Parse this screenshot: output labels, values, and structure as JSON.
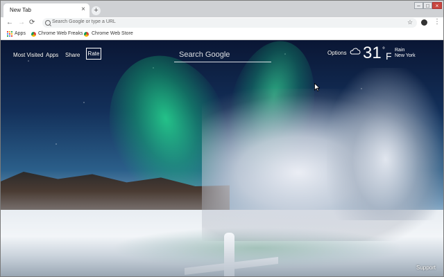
{
  "browser": {
    "tab_title": "New Tab",
    "tab_close": "×",
    "new_tab": "+",
    "window_controls": {
      "minimize": "–",
      "maximize": "□",
      "close": "×"
    },
    "toolbar": {
      "back": "←",
      "forward": "→",
      "reload": "⟳",
      "omnibox_placeholder": "Search Google or type a URL",
      "star": "☆",
      "menu": "⋮"
    },
    "bookmarks": [
      "Apps",
      "Chrome Web Freaks",
      "Chrome Web Store"
    ]
  },
  "page": {
    "links": [
      "Most Visited",
      "Apps",
      "Share"
    ],
    "rate_label": "Rate",
    "search_placeholder": "Search Google",
    "options_label": "Options",
    "weather": {
      "temperature": "31",
      "degree_symbol": "°",
      "unit": "F",
      "condition": "Rain",
      "city": "New York"
    },
    "support_label": "Support"
  },
  "colors": {
    "apps_grid": [
      "#ea4335",
      "#fbbc05",
      "#34a853",
      "#4285f4",
      "#ea4335",
      "#fbbc05",
      "#34a853",
      "#4285f4",
      "#ea4335"
    ]
  }
}
